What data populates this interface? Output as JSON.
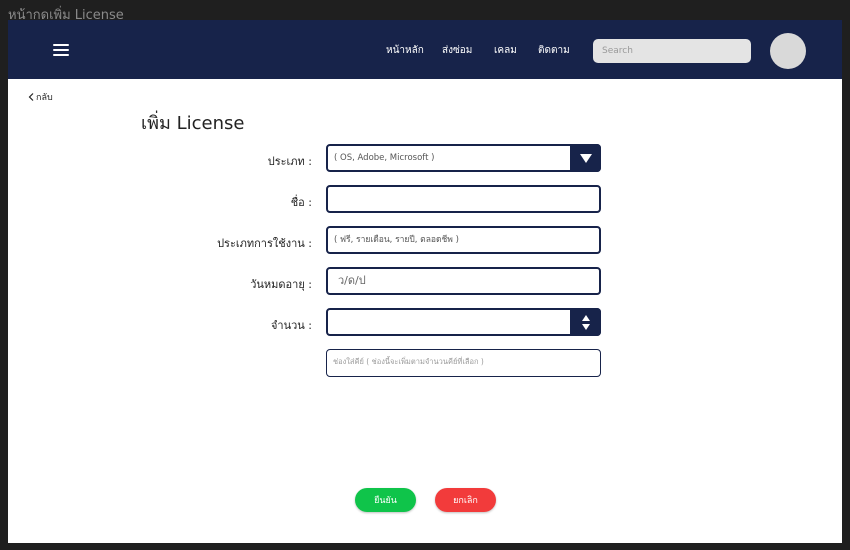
{
  "window": {
    "title": "หน้ากดเพิ่ม License"
  },
  "nav": {
    "links": [
      "หน้าหลัก",
      "ส่งซ่อม",
      "เคลม",
      "ติดตาม"
    ],
    "search_placeholder": "Search"
  },
  "page": {
    "back_label": "กลับ",
    "title": "เพิ่ม License"
  },
  "form": {
    "type": {
      "label": "ประเภท :",
      "value": "( OS,  Adobe, Microsoft )"
    },
    "name": {
      "label": "ชื่อ :",
      "value": ""
    },
    "usage_type": {
      "label": "ประเภทการใช้งาน :",
      "value": "( ฟรี, รายเดือน, รายปี, ตลอดชีพ )"
    },
    "expiry": {
      "label": "วันหมดอายุ :",
      "placeholder": "ว/ด/ป"
    },
    "quantity": {
      "label": "จำนวน :",
      "value": ""
    },
    "key": {
      "placeholder": "ช่องใส่คีย์ ( ช่องนี้จะเพิ่มตามจำนวนคีย์ที่เลือก )"
    }
  },
  "actions": {
    "confirm": "ยืนยัน",
    "cancel": "ยกเลิก"
  },
  "colors": {
    "navbar": "#17234a",
    "confirm": "#0fc44a",
    "cancel": "#f23b3b"
  },
  "icons": [
    "hamburger-icon",
    "chevron-left-icon",
    "dropdown-arrow-icon",
    "stepper-icon"
  ]
}
